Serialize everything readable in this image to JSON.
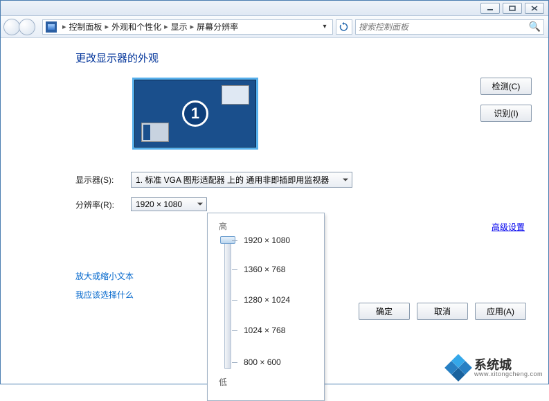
{
  "window": {
    "controls": {
      "min": "min",
      "max": "max",
      "close": "close"
    }
  },
  "nav": {
    "crumbs": [
      "控制面板",
      "外观和个性化",
      "显示",
      "屏幕分辨率"
    ],
    "search_placeholder": "搜索控制面板"
  },
  "page": {
    "title": "更改显示器的外观",
    "monitor_number": "1",
    "detect_btn": "检测(C)",
    "identify_btn": "识别(I)",
    "display_label": "显示器(S):",
    "display_value": "1. 标准 VGA 图形适配器 上的 通用非即插即用监视器",
    "resolution_label": "分辨率(R):",
    "resolution_value": "1920 × 1080",
    "advanced": "高级设置",
    "link_resize": "放大或缩小文本",
    "link_which": "我应该选择什么",
    "ok": "确定",
    "cancel": "取消",
    "apply": "应用(A)"
  },
  "res_popup": {
    "high": "高",
    "low": "低",
    "options": [
      "1920 × 1080",
      "1360 × 768",
      "1280 × 1024",
      "1024 × 768",
      "800 × 600"
    ]
  },
  "watermark": {
    "name": "系统城",
    "url": "www.xitongcheng.com"
  }
}
